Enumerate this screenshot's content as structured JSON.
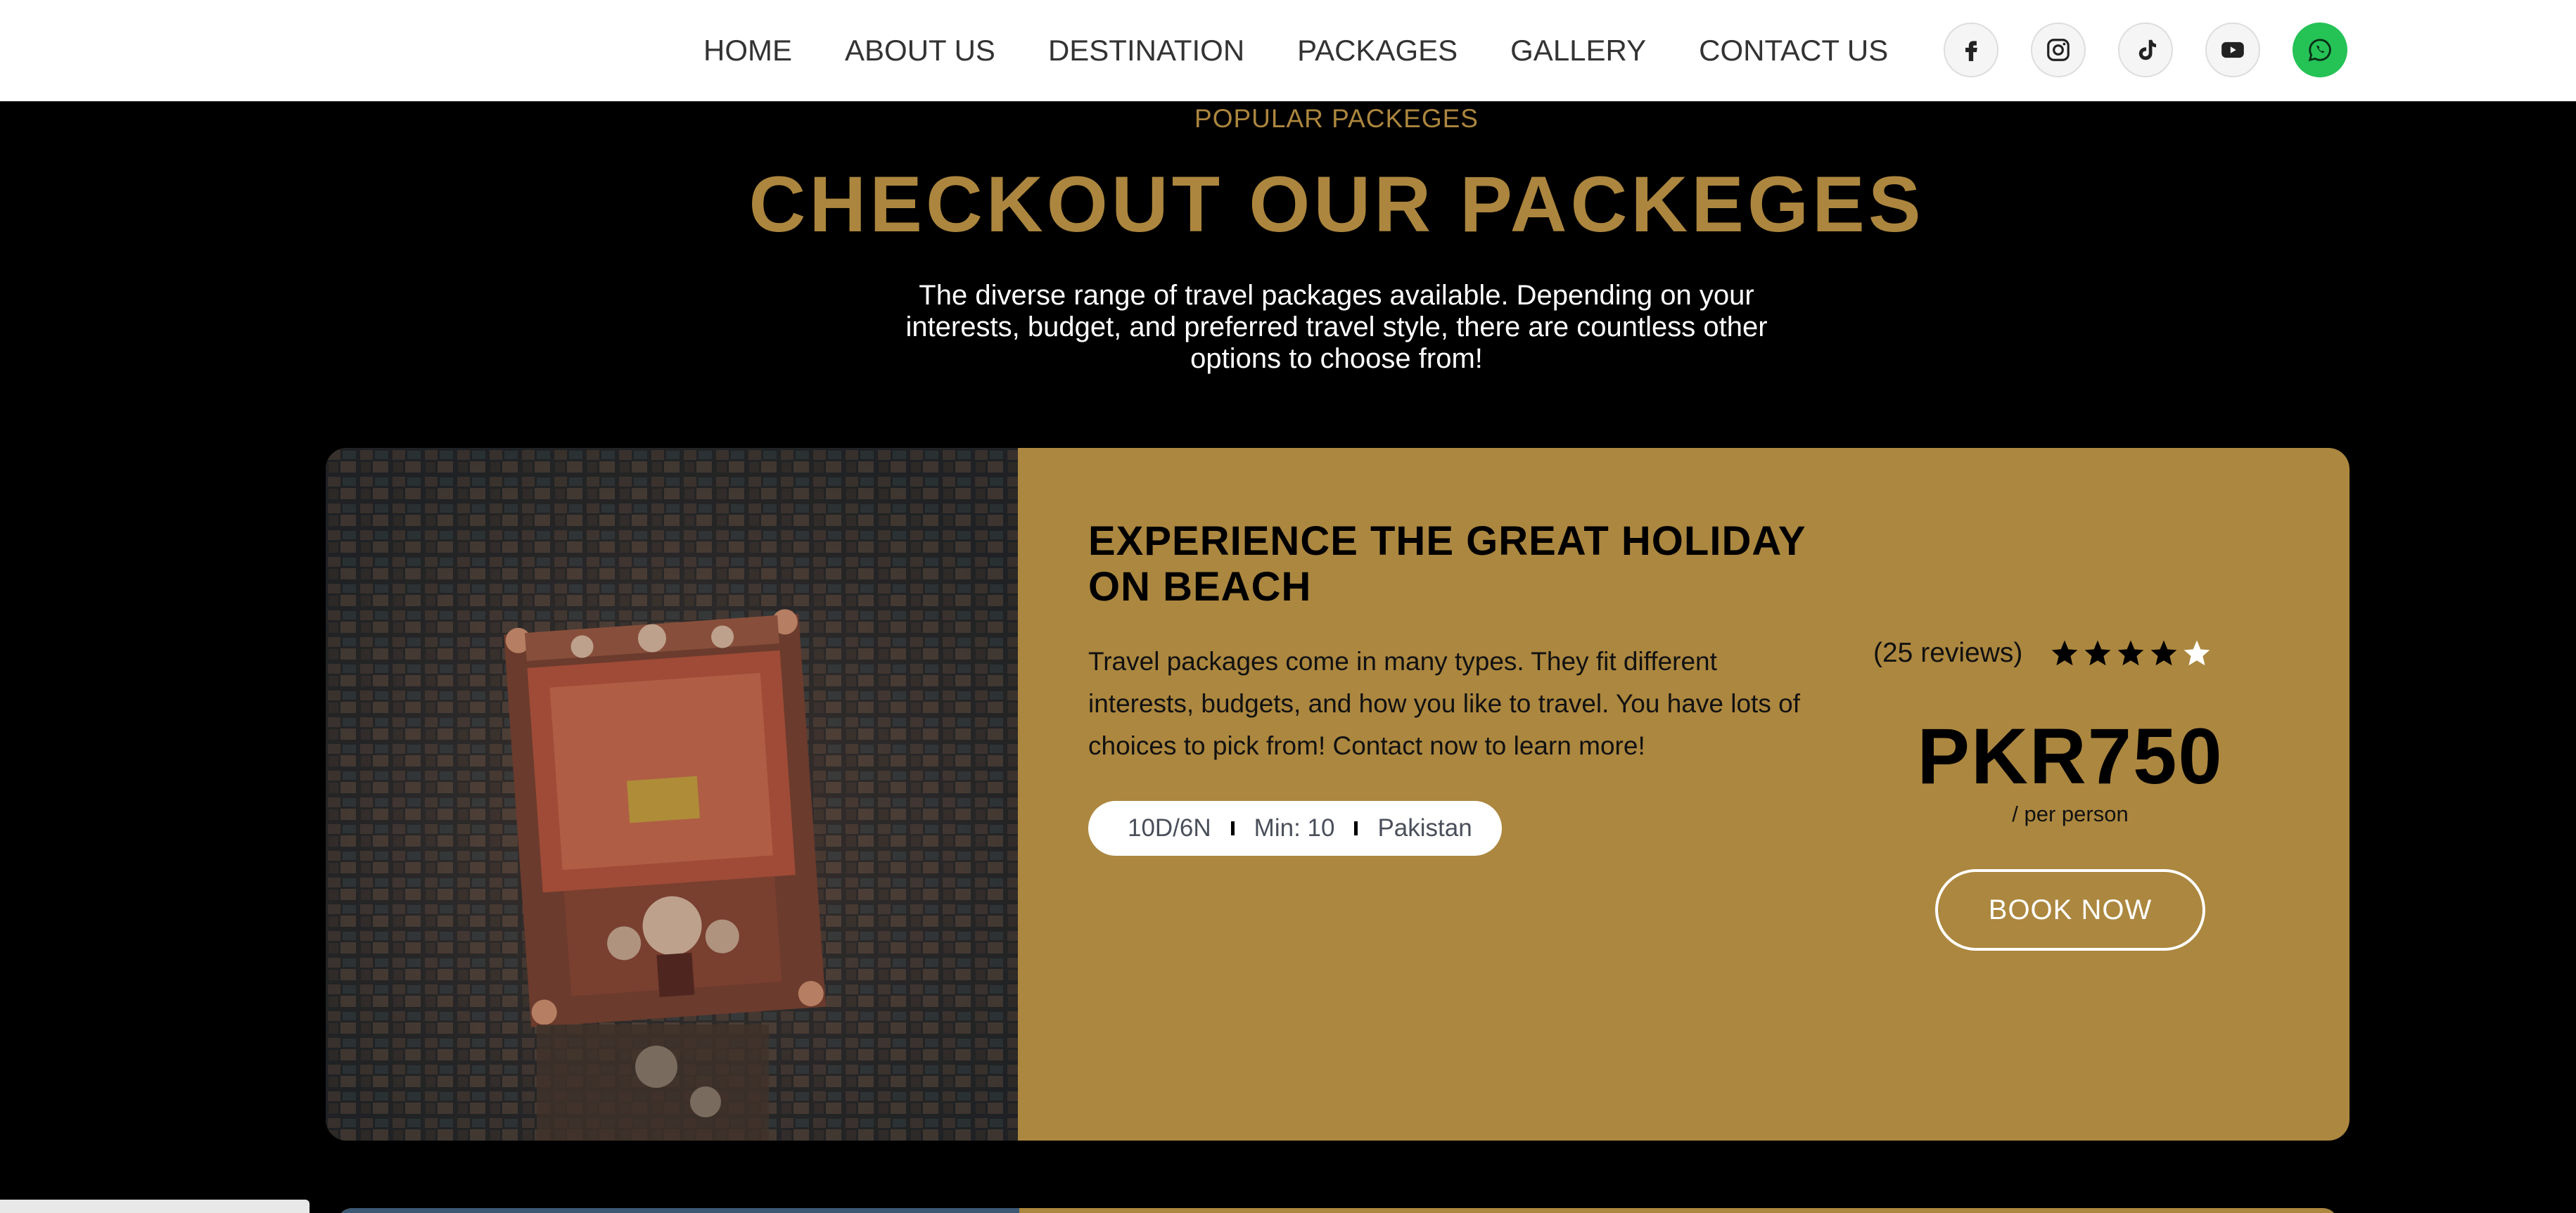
{
  "nav": {
    "links": [
      "HOME",
      "ABOUT US",
      "DESTINATION",
      "PACKAGES",
      "GALLERY",
      "CONTACT US"
    ],
    "socials": [
      "facebook-icon",
      "instagram-icon",
      "tiktok-icon",
      "youtube-icon",
      "whatsapp-icon"
    ]
  },
  "section": {
    "eyebrow": "POPULAR PACKEGES",
    "headline": "CHECKOUT OUR PACKEGES",
    "intro": "The diverse range of travel packages available. Depending on your interests, budget, and preferred travel style, there are countless other options to choose from!"
  },
  "card": {
    "title": "EXPERIENCE THE GREAT HOLIDAY ON BEACH",
    "description": "Travel packages come in many types. They fit different interests, budgets, and how you like to travel. You have lots of choices to pick from! Contact now to learn more!",
    "duration": "10D/6N",
    "min_people": "Min: 10",
    "location": "Pakistan",
    "reviews": "(25 reviews)",
    "rating": 4,
    "rating_max": 5,
    "price": "PKR750",
    "per": "/ per person",
    "book_label": "BOOK NOW"
  },
  "colors": {
    "accent": "#ac873f",
    "headline": "#ac863e",
    "whatsapp": "#25c256"
  }
}
